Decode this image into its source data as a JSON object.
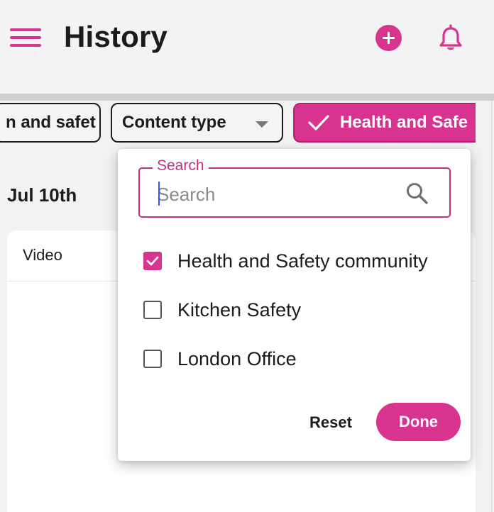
{
  "header": {
    "title": "History",
    "icons": {
      "menu": "hamburger-menu-icon",
      "add": "add-circle-icon",
      "notifications": "bell-icon"
    },
    "accent_color": "#d8348f"
  },
  "filters": {
    "chips": [
      {
        "label": "n and safet",
        "selected": false
      },
      {
        "label": "Content type",
        "selected": false,
        "has_dropdown": true
      },
      {
        "label": "Health and Safe",
        "selected": true,
        "icon": "check-icon"
      }
    ]
  },
  "main": {
    "date_heading": "Jul 10th",
    "card": {
      "label": "Video"
    }
  },
  "dropdown": {
    "search": {
      "label": "Search",
      "placeholder": "Search",
      "value": ""
    },
    "options": [
      {
        "label": "Health and Safety community",
        "checked": true
      },
      {
        "label": "Kitchen Safety",
        "checked": false
      },
      {
        "label": "London Office",
        "checked": false
      }
    ],
    "reset_label": "Reset",
    "done_label": "Done"
  }
}
